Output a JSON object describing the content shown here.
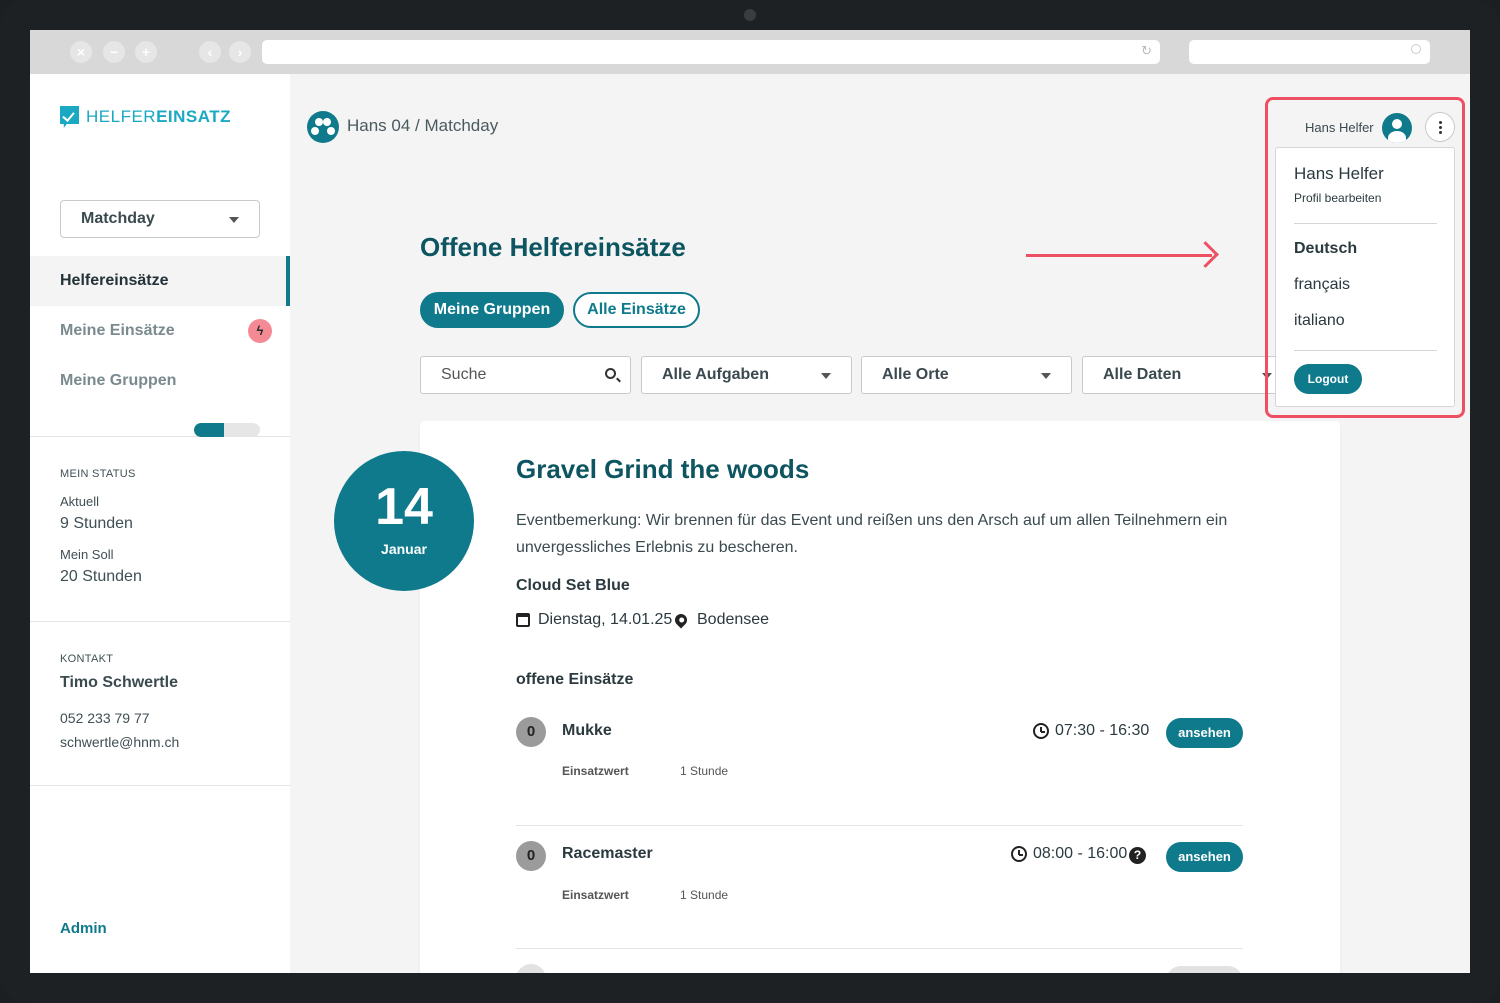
{
  "brand": {
    "light": "HELFER",
    "bold": "EINSATZ"
  },
  "sidebar": {
    "event_select": "Matchday",
    "nav": [
      {
        "label": "Helfereinsätze",
        "active": true
      },
      {
        "label": "Meine Einsätze",
        "badge_icon": "lightning-icon"
      },
      {
        "label": "Meine Gruppen"
      }
    ],
    "status": {
      "heading": "MEIN STATUS",
      "progress_fraction": 0.45,
      "current_label": "Aktuell",
      "current_value": "9 Stunden",
      "target_label": "Mein Soll",
      "target_value": "20 Stunden"
    },
    "contact": {
      "heading": "KONTAKT",
      "name": "Timo Schwertle",
      "phone": "052 233 79 77",
      "email": "schwertle@hnm.ch"
    },
    "admin_link": "Admin"
  },
  "header": {
    "breadcrumb": "Hans 04 / Matchday",
    "user_name": "Hans Helfer"
  },
  "user_menu": {
    "name": "Hans Helfer",
    "edit_profile": "Profil bearbeiten",
    "languages": [
      "Deutsch",
      "français",
      "italiano"
    ],
    "current_language": "Deutsch",
    "logout": "Logout"
  },
  "main": {
    "title": "Offene Helfereinsätze",
    "tabs": [
      "Meine Gruppen",
      "Alle Einsätze"
    ],
    "filters": {
      "search_placeholder": "Suche",
      "tasks": "Alle Aufgaben",
      "places": "Alle Orte",
      "dates": "Alle Daten"
    }
  },
  "event": {
    "day": "14",
    "month": "Januar",
    "title": "Gravel Grind the woods",
    "remark": "Eventbemerkung: Wir brennen für das Event und reißen uns den Arsch auf um allen Teilnehmern ein unvergessliches Erlebnis zu bescheren.",
    "subtitle": "Cloud Set Blue",
    "date": "Dienstag, 14.01.25",
    "location": "Bodensee",
    "section_label": "offene Einsätze",
    "tasks": [
      {
        "count": "0",
        "name": "Mukke",
        "time": "07:30 - 16:30",
        "value_label": "Einsatzwert",
        "value": "1 Stunde",
        "button": "ansehen"
      },
      {
        "count": "0",
        "name": "Racemaster",
        "time": "08:00 - 16:00",
        "value_label": "Einsatzwert",
        "value": "1 Stunde",
        "button": "ansehen",
        "help": "?"
      }
    ]
  },
  "colors": {
    "primary": "#0f7a8c",
    "title": "#0d5560",
    "accent_logo": "#1aa8c2",
    "highlight": "#ef4f62",
    "badge": "#f48b94"
  }
}
